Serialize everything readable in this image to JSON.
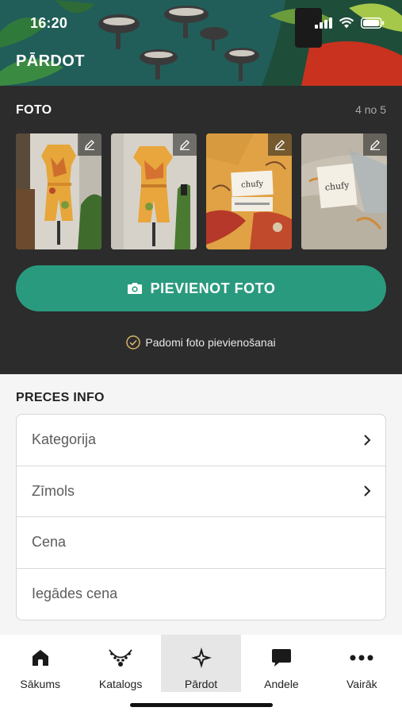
{
  "status_bar": {
    "time": "16:20"
  },
  "header": {
    "title": "PĀRDOT"
  },
  "photos": {
    "section_label": "FOTO",
    "count": "4 no 5",
    "thumbnails": [
      {
        "subject": "jumpsuit-front"
      },
      {
        "subject": "jumpsuit-back"
      },
      {
        "subject": "fabric-label-chufy"
      },
      {
        "subject": "neck-label-chufy"
      }
    ],
    "label_text": "chufy",
    "add_button": "PIEVIENOT FOTO",
    "tips": "Padomi foto pievienošanai"
  },
  "product_info": {
    "title": "PRECES INFO",
    "rows": [
      {
        "label": "Kategorija",
        "has_chevron": true
      },
      {
        "label": "Zīmols",
        "has_chevron": true
      },
      {
        "label": "Cena",
        "has_chevron": false
      },
      {
        "label": "Iegādes cena",
        "has_chevron": false
      }
    ]
  },
  "bottom_nav": {
    "items": [
      {
        "label": "Sākums",
        "icon": "home-icon"
      },
      {
        "label": "Katalogs",
        "icon": "necklace-icon"
      },
      {
        "label": "Pārdot",
        "icon": "sparkle-icon",
        "active": true
      },
      {
        "label": "Andele",
        "icon": "chat-bubble-icon"
      },
      {
        "label": "Vairāk",
        "icon": "more-dots-icon"
      }
    ]
  },
  "colors": {
    "accent": "#2a9a7e",
    "dark_section": "#2c2c2c",
    "header_teal": "#1f5f5a"
  }
}
